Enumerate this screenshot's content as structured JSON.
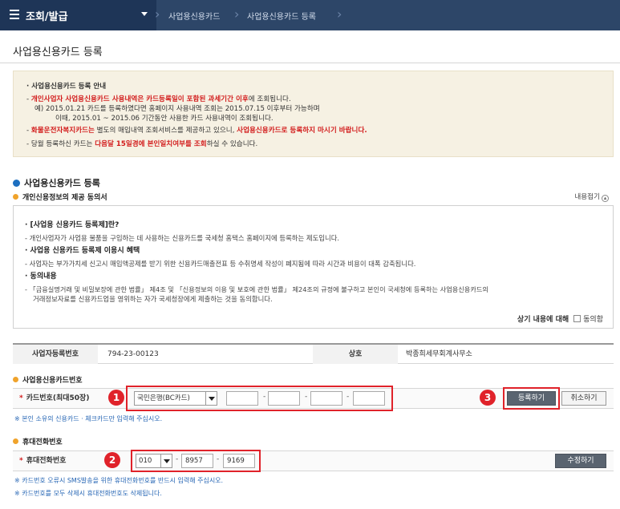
{
  "topbar": {
    "menu_title": "조회/발급",
    "crumbs": [
      "사업용신용카드",
      "사업용신용카드 등록"
    ]
  },
  "page_title": "사업용신용카드 등록",
  "notice": {
    "heading": "· 사업용신용카드 등록 안내",
    "l1_pre": "- ",
    "l1_red": "개인사업자 사업용신용카드 사용내역은 카드등록일이 포함된 과세기간 이후",
    "l1_post": "에 조회됩니다.",
    "l2": "예) 2015.01.21 카드를 등록하였다면 홈페이지 사용내역 조회는 2015.07.15 이후부터 가능하며",
    "l3": "이때, 2015.01 ~ 2015.06 기간동안 사용한 카드 사용내역이 조회됩니다.",
    "l4_pre": "- ",
    "l4_red1": "화물운전자복지카드는",
    "l4_mid": " 별도의 매입내역 조회서비스를 제공하고 있으니, ",
    "l4_red2": "사업용신용카드로 등록하지 마시기 바랍니다.",
    "l5_pre": "- 당월 등록하신 카드는 ",
    "l5_red": "다음달 15일경에 본인일치여부를 조회",
    "l5_post": "하실 수 있습니다."
  },
  "section_title": "사업용신용카드 등록",
  "consent": {
    "title": "개인신용정보의 제공 동의서",
    "collapse_label": "내용접기",
    "q1": "· [사업용 신용카드 등록제]란?",
    "a1": "- 개인사업자가 사업용 물품을 구입하는 데 사용하는 신용카드를 국세청 홈택스 홈페이지에 등록하는 제도입니다.",
    "q2": "· 사업용 신용카드 등록제 이용시 혜택",
    "a2": "- 사업자는 부가가치세 신고시 매입액공제를 받기 위한 신용카드매출전표 등 수취명세 작성이 폐지됨에 따라 시간과 비용이 대폭 감축됩니다.",
    "q3": "· 동의내용",
    "a3a": "- 「금융실명거래 및 비밀보장에 관한 법률」 제4조 및 「신용정보의 이용 및 보호에 관한 법률」 제24조의 규정에 불구하고 본인이 국세청에 등록하는 사업용신용카드의",
    "a3b": "거래정보자료를 신용카드업을 영위하는 자가 국세청장에게 제출하는 것을 동의합니다.",
    "agree_prefix": "상기 내용에 대해",
    "agree_label": "동의함"
  },
  "biz": {
    "reg_label": "사업자등록번호",
    "reg_value": "794-23-00123",
    "name_label": "상호",
    "name_value": "박종희세무회계사무소"
  },
  "card": {
    "section": "사업용신용카드번호",
    "label": "카드번호(최대50장)",
    "bank": "국민은행(BC카드)",
    "register_btn": "등록하기",
    "cancel_btn": "취소하기",
    "note": "※ 본인 소유의 신용카드 · 체크카드만 입력해 주십시오."
  },
  "phone": {
    "section": "휴대전화번호",
    "label": "휴대전화번호",
    "p1": "010",
    "p2": "8957",
    "p3": "9169",
    "edit_btn": "수정하기",
    "note1": "※ 카드번호 오류시 SMS발송을 위한 휴대전화번호를 반드시 입력해 주십시오.",
    "note2": "※ 카드번호를 모두 삭제시 휴대전화번호도 삭제됩니다."
  },
  "badges": [
    "1",
    "2",
    "3"
  ],
  "colors": {
    "topbar": "#2d4668",
    "highlight_red": "#e0222a",
    "notice_bg": "#f6f1e3",
    "link_blue": "#2565b4"
  }
}
